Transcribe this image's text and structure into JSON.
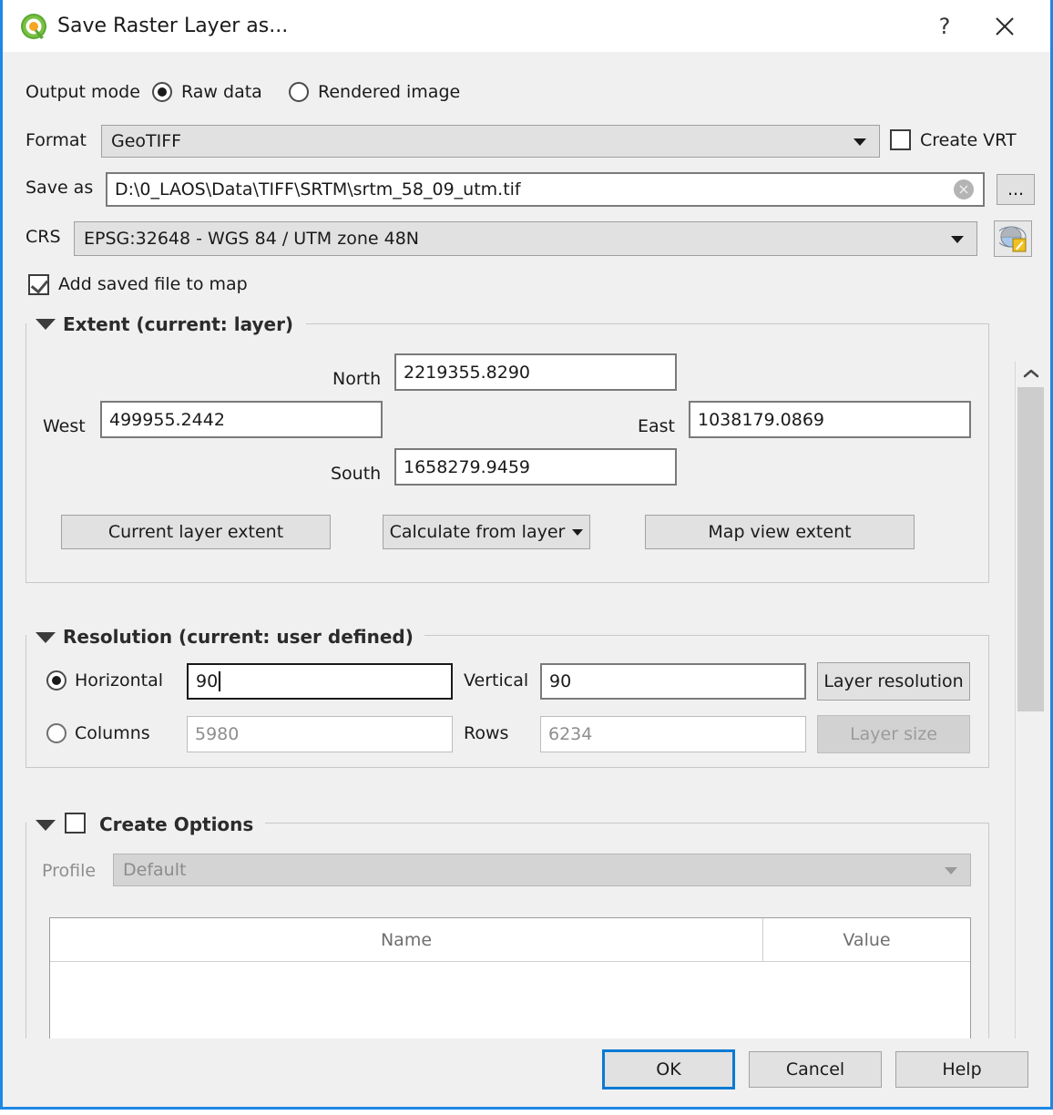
{
  "window": {
    "title": "Save Raster Layer as...",
    "help_glyph": "?",
    "close_glyph": "×",
    "accent_color": "#1e88e5",
    "logo_name": "qgis-logo-icon"
  },
  "output_mode": {
    "label": "Output mode",
    "options": [
      {
        "label": "Raw data",
        "selected": true
      },
      {
        "label": "Rendered image",
        "selected": false
      }
    ]
  },
  "format": {
    "label": "Format",
    "value": "GeoTIFF"
  },
  "create_vrt": {
    "label": "Create VRT",
    "checked": false
  },
  "save_as": {
    "label": "Save as",
    "value": "D:\\0_LAOS\\Data\\TIFF\\SRTM\\srtm_58_09_utm.tif",
    "clear_icon": "×",
    "browse_label": "..."
  },
  "crs": {
    "label": "CRS",
    "value": "EPSG:32648 - WGS 84 / UTM zone 48N",
    "select_button_name": "select-crs-button"
  },
  "add_saved_file": {
    "label": "Add saved file to map",
    "checked": true
  },
  "extent": {
    "title": "Extent (current: layer)",
    "north_label": "North",
    "north_value": "2219355.8290",
    "west_label": "West",
    "west_value": "499955.2442",
    "east_label": "East",
    "east_value": "1038179.0869",
    "south_label": "South",
    "south_value": "1658279.9459",
    "buttons": {
      "current_layer_extent": "Current layer extent",
      "calculate_from_layer": "Calculate from layer",
      "map_view_extent": "Map view extent"
    }
  },
  "resolution": {
    "title": "Resolution (current: user defined)",
    "horizontal_label": "Horizontal",
    "horizontal_value": "90",
    "horizontal_selected": true,
    "vertical_label": "Vertical",
    "vertical_value": "90",
    "layer_resolution_label": "Layer resolution",
    "columns_label": "Columns",
    "columns_value": "5980",
    "columns_selected": false,
    "rows_label": "Rows",
    "rows_value": "6234",
    "layer_size_label": "Layer size"
  },
  "create_options": {
    "title": "Create Options",
    "checked": false,
    "profile_label": "Profile",
    "profile_value": "Default",
    "table": {
      "columns": [
        "Name",
        "Value"
      ],
      "rows": []
    }
  },
  "dialog_buttons": {
    "ok": "OK",
    "cancel": "Cancel",
    "help": "Help"
  }
}
